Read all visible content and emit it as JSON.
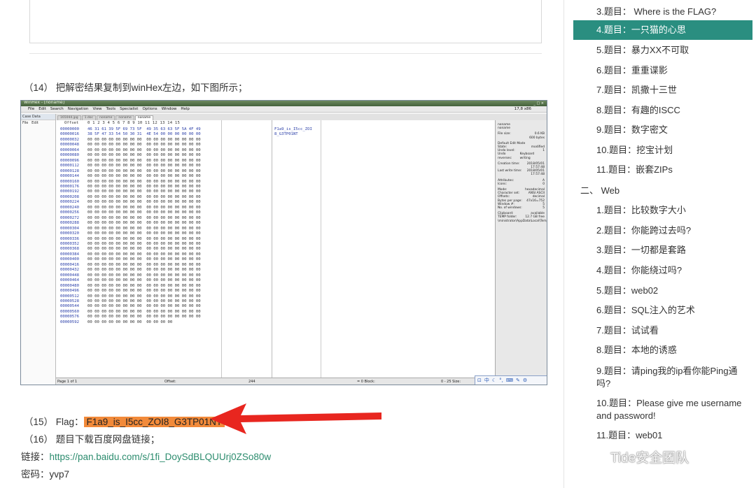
{
  "article": {
    "step14": "（14） 把解密结果复制到winHex左边，如下图所示；",
    "step15_prefix": "（15） Flag：",
    "flag": "F1a9_is_I5cc_ZOI8_G3TP01NT",
    "step16": "（16） 题目下载百度网盘链接；",
    "link_label": "链接：",
    "link_url": "https://pan.baidu.com/s/1fi_DoySdBLQUUrj0ZSo80w",
    "pwd_label": "密码：",
    "pwd": "yvp7"
  },
  "winhex": {
    "window_title": "WinHex - [noname]",
    "title_buttons": "_ □ ×",
    "menus": [
      "File",
      "Edit",
      "Search",
      "Navigation",
      "View",
      "Tools",
      "Specialist",
      "Options",
      "Window",
      "Help"
    ],
    "menu_info": "17,8 x86",
    "left_panel_header": "Case Data",
    "left_panel_menus": [
      "File",
      "Edit"
    ],
    "tabs": [
      "165044.jpg",
      "1.doc",
      "noname",
      "noname",
      "noname"
    ],
    "offset_header": "Offset",
    "column_header": "0  1  2  3  4  5  6  7   8  9 10 11 12 13 14 15",
    "offsets": [
      "00000000",
      "00000016",
      "00000032",
      "00000048",
      "00000064",
      "00000080",
      "00000096",
      "00000112",
      "00000128",
      "00000144",
      "00000160",
      "00000176",
      "00000192",
      "00000208",
      "00000224",
      "00000240",
      "00000256",
      "00000272",
      "00000288",
      "00000304",
      "00000320",
      "00000336",
      "00000352",
      "00000368",
      "00000384",
      "00000400",
      "00000416",
      "00000432",
      "00000448",
      "00000464",
      "00000480",
      "00000496",
      "00000512",
      "00000528",
      "00000544",
      "00000560",
      "00000576",
      "00000592"
    ],
    "row0": "46 31 61 39 5F 69 73 5F  49 35 63 63 5F 5A 4F 49",
    "row1": "38 5F 47 33 54 50 30 31  4E 54 00 00 00 00 00 00",
    "zero_row": "00 00 00 00 00 00 00 00  00 00 00 00 00 00 00 00",
    "last_row": "00 00 00 00 00 00 00 00  00 00 00 00",
    "text_line1": "F1a9_is_I5cc_ZOI",
    "text_line2": "8_G3TP01NT",
    "info": [
      [
        "noname",
        ""
      ],
      [
        "noname",
        ""
      ],
      [
        "File size:",
        "0.6 KB"
      ],
      [
        "",
        "600 bytes"
      ],
      [
        "Default Edit Mode",
        ""
      ],
      [
        "State:",
        "modified"
      ],
      [
        "Undo level:",
        "1"
      ],
      [
        "Undo reverses:",
        "Keyboard writing"
      ],
      [
        "Creation time:",
        "2018/05/01"
      ],
      [
        "",
        "17:57:48"
      ],
      [
        "Last write time:",
        "2018/05/01"
      ],
      [
        "",
        "17:57:48"
      ],
      [
        "Attributes:",
        "A"
      ],
      [
        "Icons:",
        "0"
      ],
      [
        "Mode:",
        "hexadecimal"
      ],
      [
        "Character set:",
        "ANSI ASCII"
      ],
      [
        "Offsets:",
        "decimal"
      ],
      [
        "Bytes per page:",
        "47x16=752"
      ],
      [
        "Window #:",
        "5"
      ],
      [
        "No. of windows:",
        "5"
      ],
      [
        "Clipboard:",
        "available"
      ],
      [
        "TEMP folder:",
        "12.7 GB free"
      ],
      [
        "",
        "\\ministrator\\AppData\\Local\\Temp"
      ]
    ],
    "status_page": "Page 1 of 1",
    "status_offset": "Offset:",
    "status_offset_val": "244",
    "status_block": "= 0  Block:",
    "status_size": "0 - 25  Size:",
    "ime": "中"
  },
  "toc": {
    "items": [
      {
        "label": "3.题目： Where is the FLAG?"
      },
      {
        "label": "4.题目：一只猫的心思"
      },
      {
        "label": "5.题目：暴力XX不可取"
      },
      {
        "label": "6.题目：重重谍影"
      },
      {
        "label": "7.题目：凯撒十三世"
      },
      {
        "label": "8.题目：有趣的ISCC"
      },
      {
        "label": "9.题目：数字密文"
      },
      {
        "label": "10.题目：挖宝计划"
      },
      {
        "label": "11.题目：嵌套ZIPs"
      },
      {
        "label": "二、 Web"
      },
      {
        "label": "1.题目：比较数字大小"
      },
      {
        "label": "2.题目：你能跨过去吗?"
      },
      {
        "label": "3.题目：一切都是套路"
      },
      {
        "label": "4.题目：你能绕过吗?"
      },
      {
        "label": "5.题目：web02"
      },
      {
        "label": "6.题目：SQL注入的艺术"
      },
      {
        "label": "7.题目：试试看"
      },
      {
        "label": "8.题目：本地的诱惑"
      },
      {
        "label": "9.题目：请ping我的ip看你能Ping通吗?"
      },
      {
        "label": "10.题目：Please give me username and password!"
      },
      {
        "label": "11.题目：web01"
      }
    ],
    "active_color": "#2a8e80"
  },
  "watermark": "Tide安全团队",
  "colors": {
    "flag_highlight": "#f28a3a",
    "link": "#2c8c6e",
    "arrow": "#e8261f"
  }
}
